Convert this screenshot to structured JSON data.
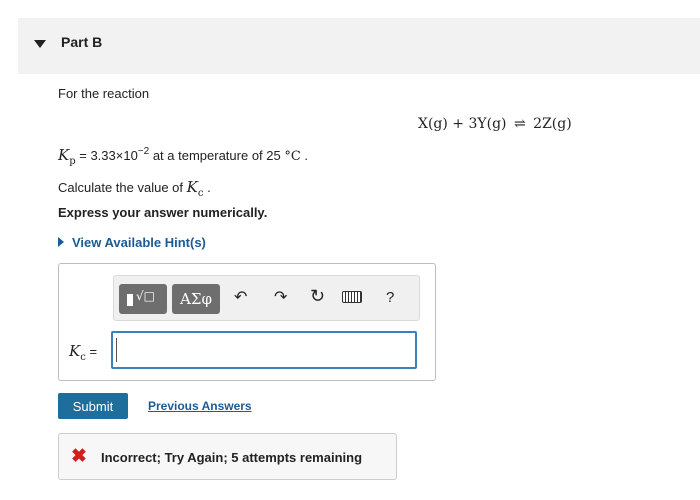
{
  "part": {
    "title": "Part B"
  },
  "question": {
    "intro": "For the reaction",
    "equation": {
      "left": "X(g) + 3Y(g)",
      "arrow": "⇌",
      "right": "2Z(g)"
    },
    "kp": {
      "symbol": "K",
      "subscript": "p",
      "equals_value": " = 3.33×10",
      "exponent": "−2",
      "tail": " at a temperature of 25 ",
      "unit": "°C",
      "period": " ."
    },
    "calc": {
      "prefix": "Calculate the value of ",
      "symbol": "K",
      "subscript": "c",
      "period": " ."
    },
    "express": "Express your answer numerically."
  },
  "hint": {
    "label": "View Available Hint(s)"
  },
  "toolbar": {
    "templates_label": "√□",
    "symbols_label": "ΑΣφ",
    "undo_glyph": "↶",
    "redo_glyph": "↷",
    "reset_glyph": "↻",
    "help_glyph": "?",
    "icons": [
      "templates-icon",
      "symbols-icon",
      "undo-icon",
      "redo-icon",
      "reset-icon",
      "keyboard-icon",
      "help-icon"
    ]
  },
  "answer": {
    "label_symbol": "K",
    "label_subscript": "c",
    "label_equals": " =",
    "value": ""
  },
  "actions": {
    "submit_label": "Submit",
    "previous_label": "Previous Answers"
  },
  "feedback": {
    "icon": "✖",
    "message": "Incorrect; Try Again; 5 attempts remaining"
  },
  "colors": {
    "accent": "#1f6d9a",
    "link": "#1d5a96",
    "error": "#d11f1f",
    "input_border": "#3a7fbf"
  }
}
